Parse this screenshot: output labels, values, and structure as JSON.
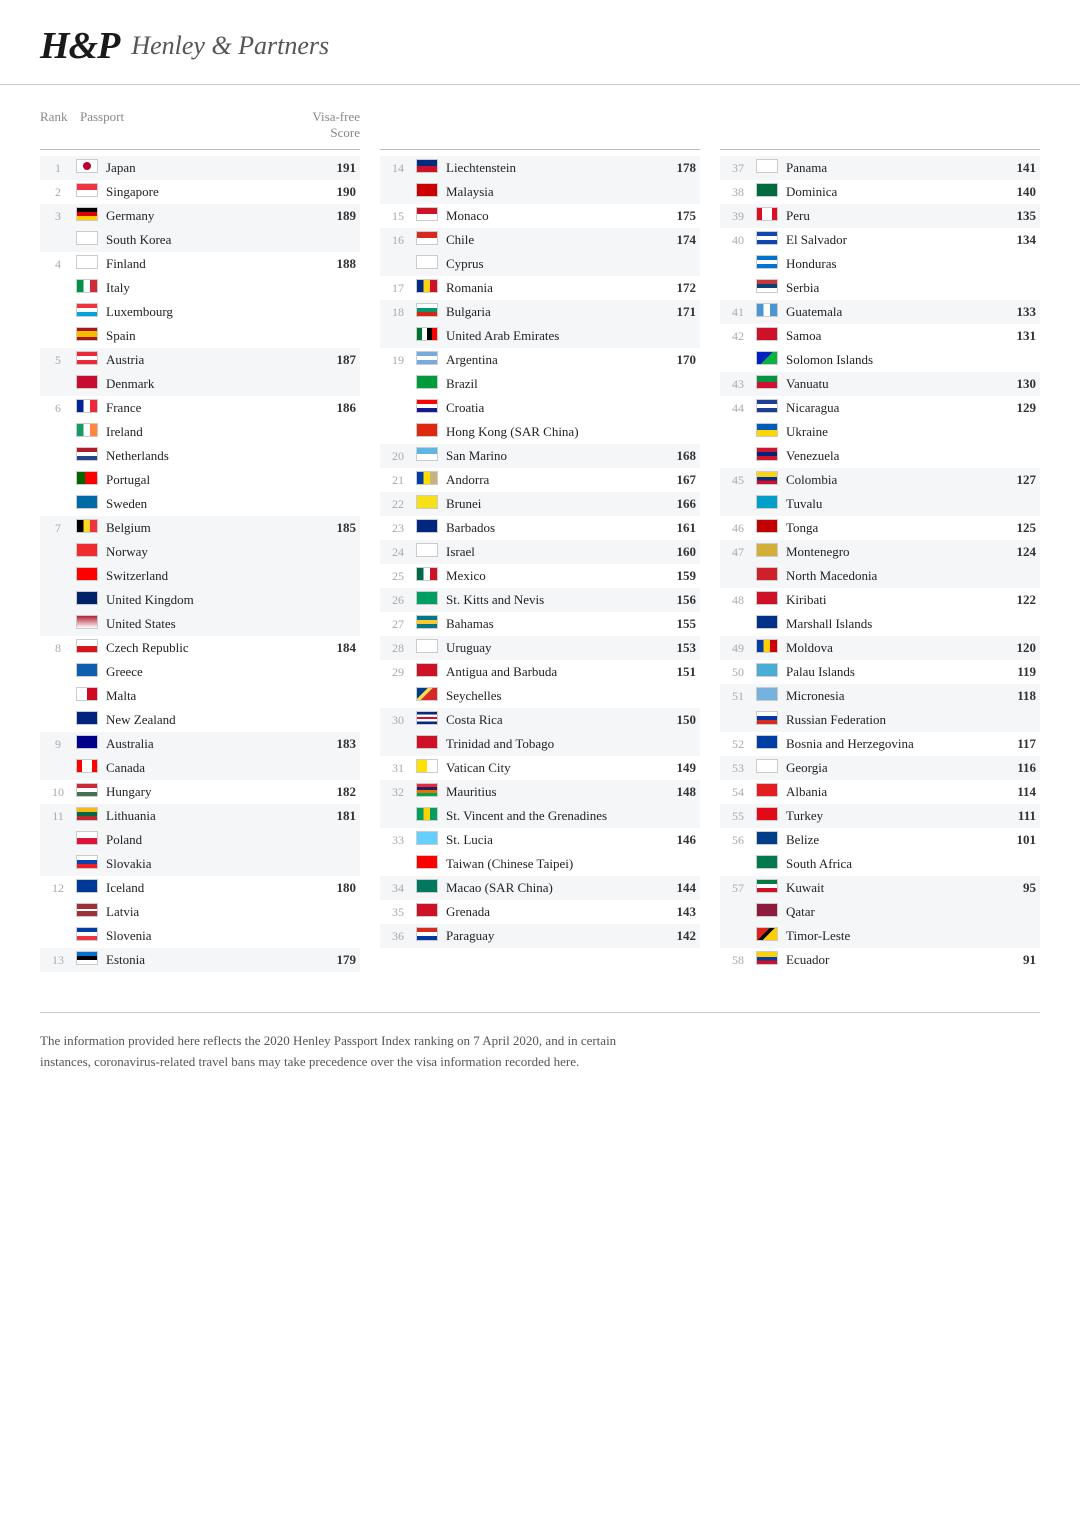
{
  "header": {
    "logo": "H&P",
    "name": "Henley & Partners"
  },
  "columns_header": {
    "rank": "Rank",
    "passport": "Passport",
    "score": "Visa-free Score"
  },
  "footer": {
    "text1": "The information provided here reflects the 2020 Henley Passport Index ranking on 7 April 2020, and in certain",
    "text2": "instances, coronavirus-related travel bans may take precedence over the visa information recorded here."
  },
  "col1": [
    {
      "rank": "1",
      "name": "Japan",
      "score": "191",
      "flag": "jp",
      "shaded": true
    },
    {
      "rank": "2",
      "name": "Singapore",
      "score": "190",
      "flag": "sg",
      "shaded": false
    },
    {
      "rank": "3",
      "name": "Germany",
      "score": "189",
      "flag": "de",
      "shaded": true
    },
    {
      "rank": "",
      "name": "South Korea",
      "score": "",
      "flag": "kr",
      "shaded": true
    },
    {
      "rank": "4",
      "name": "Finland",
      "score": "188",
      "flag": "fi",
      "shaded": false
    },
    {
      "rank": "",
      "name": "Italy",
      "score": "",
      "flag": "it",
      "shaded": false
    },
    {
      "rank": "",
      "name": "Luxembourg",
      "score": "",
      "flag": "lu",
      "shaded": false
    },
    {
      "rank": "",
      "name": "Spain",
      "score": "",
      "flag": "es",
      "shaded": false
    },
    {
      "rank": "5",
      "name": "Austria",
      "score": "187",
      "flag": "at",
      "shaded": true
    },
    {
      "rank": "",
      "name": "Denmark",
      "score": "",
      "flag": "dk",
      "shaded": true
    },
    {
      "rank": "6",
      "name": "France",
      "score": "186",
      "flag": "fr",
      "shaded": false
    },
    {
      "rank": "",
      "name": "Ireland",
      "score": "",
      "flag": "ie",
      "shaded": false
    },
    {
      "rank": "",
      "name": "Netherlands",
      "score": "",
      "flag": "nl",
      "shaded": false
    },
    {
      "rank": "",
      "name": "Portugal",
      "score": "",
      "flag": "pt",
      "shaded": false
    },
    {
      "rank": "",
      "name": "Sweden",
      "score": "",
      "flag": "se",
      "shaded": false
    },
    {
      "rank": "7",
      "name": "Belgium",
      "score": "185",
      "flag": "be",
      "shaded": true
    },
    {
      "rank": "",
      "name": "Norway",
      "score": "",
      "flag": "no",
      "shaded": true
    },
    {
      "rank": "",
      "name": "Switzerland",
      "score": "",
      "flag": "ch",
      "shaded": true
    },
    {
      "rank": "",
      "name": "United Kingdom",
      "score": "",
      "flag": "gb",
      "shaded": true
    },
    {
      "rank": "",
      "name": "United States",
      "score": "",
      "flag": "us",
      "shaded": true
    },
    {
      "rank": "8",
      "name": "Czech Republic",
      "score": "184",
      "flag": "cz",
      "shaded": false
    },
    {
      "rank": "",
      "name": "Greece",
      "score": "",
      "flag": "gr",
      "shaded": false
    },
    {
      "rank": "",
      "name": "Malta",
      "score": "",
      "flag": "mt",
      "shaded": false
    },
    {
      "rank": "",
      "name": "New Zealand",
      "score": "",
      "flag": "nz",
      "shaded": false
    },
    {
      "rank": "9",
      "name": "Australia",
      "score": "183",
      "flag": "au",
      "shaded": true
    },
    {
      "rank": "",
      "name": "Canada",
      "score": "",
      "flag": "ca",
      "shaded": true
    },
    {
      "rank": "10",
      "name": "Hungary",
      "score": "182",
      "flag": "hu",
      "shaded": false
    },
    {
      "rank": "11",
      "name": "Lithuania",
      "score": "181",
      "flag": "lt",
      "shaded": true
    },
    {
      "rank": "",
      "name": "Poland",
      "score": "",
      "flag": "pl",
      "shaded": true
    },
    {
      "rank": "",
      "name": "Slovakia",
      "score": "",
      "flag": "sk",
      "shaded": true
    },
    {
      "rank": "12",
      "name": "Iceland",
      "score": "180",
      "flag": "is",
      "shaded": false
    },
    {
      "rank": "",
      "name": "Latvia",
      "score": "",
      "flag": "lv",
      "shaded": false
    },
    {
      "rank": "",
      "name": "Slovenia",
      "score": "",
      "flag": "si",
      "shaded": false
    },
    {
      "rank": "13",
      "name": "Estonia",
      "score": "179",
      "flag": "ee",
      "shaded": true
    }
  ],
  "col2": [
    {
      "rank": "14",
      "name": "Liechtenstein",
      "score": "178",
      "flag": "li",
      "shaded": true
    },
    {
      "rank": "",
      "name": "Malaysia",
      "score": "",
      "flag": "my",
      "shaded": true
    },
    {
      "rank": "15",
      "name": "Monaco",
      "score": "175",
      "flag": "mc",
      "shaded": false
    },
    {
      "rank": "16",
      "name": "Chile",
      "score": "174",
      "flag": "cl",
      "shaded": true
    },
    {
      "rank": "",
      "name": "Cyprus",
      "score": "",
      "flag": "cy",
      "shaded": true
    },
    {
      "rank": "17",
      "name": "Romania",
      "score": "172",
      "flag": "ro",
      "shaded": false
    },
    {
      "rank": "18",
      "name": "Bulgaria",
      "score": "171",
      "flag": "bg",
      "shaded": true
    },
    {
      "rank": "",
      "name": "United Arab Emirates",
      "score": "",
      "flag": "ae",
      "shaded": true
    },
    {
      "rank": "19",
      "name": "Argentina",
      "score": "170",
      "flag": "ar",
      "shaded": false
    },
    {
      "rank": "",
      "name": "Brazil",
      "score": "",
      "flag": "br",
      "shaded": false
    },
    {
      "rank": "",
      "name": "Croatia",
      "score": "",
      "flag": "hr",
      "shaded": false
    },
    {
      "rank": "",
      "name": "Hong Kong (SAR China)",
      "score": "",
      "flag": "hk",
      "shaded": false
    },
    {
      "rank": "20",
      "name": "San Marino",
      "score": "168",
      "flag": "sm",
      "shaded": true
    },
    {
      "rank": "21",
      "name": "Andorra",
      "score": "167",
      "flag": "ad",
      "shaded": false
    },
    {
      "rank": "22",
      "name": "Brunei",
      "score": "166",
      "flag": "bn",
      "shaded": true
    },
    {
      "rank": "23",
      "name": "Barbados",
      "score": "161",
      "flag": "bb",
      "shaded": false
    },
    {
      "rank": "24",
      "name": "Israel",
      "score": "160",
      "flag": "il",
      "shaded": true
    },
    {
      "rank": "25",
      "name": "Mexico",
      "score": "159",
      "flag": "mx",
      "shaded": false
    },
    {
      "rank": "26",
      "name": "St. Kitts and Nevis",
      "score": "156",
      "flag": "kn",
      "shaded": true
    },
    {
      "rank": "27",
      "name": "Bahamas",
      "score": "155",
      "flag": "bs",
      "shaded": false
    },
    {
      "rank": "28",
      "name": "Uruguay",
      "score": "153",
      "flag": "uy",
      "shaded": true
    },
    {
      "rank": "29",
      "name": "Antigua and Barbuda",
      "score": "151",
      "flag": "ag",
      "shaded": false
    },
    {
      "rank": "",
      "name": "Seychelles",
      "score": "",
      "flag": "sc",
      "shaded": false
    },
    {
      "rank": "30",
      "name": "Costa Rica",
      "score": "150",
      "flag": "cr",
      "shaded": true
    },
    {
      "rank": "",
      "name": "Trinidad and Tobago",
      "score": "",
      "flag": "tt",
      "shaded": true
    },
    {
      "rank": "31",
      "name": "Vatican City",
      "score": "149",
      "flag": "va",
      "shaded": false
    },
    {
      "rank": "32",
      "name": "Mauritius",
      "score": "148",
      "flag": "mu",
      "shaded": true
    },
    {
      "rank": "",
      "name": "St. Vincent and the Grenadines",
      "score": "",
      "flag": "vc",
      "shaded": true
    },
    {
      "rank": "33",
      "name": "St. Lucia",
      "score": "146",
      "flag": "lc",
      "shaded": false
    },
    {
      "rank": "",
      "name": "Taiwan (Chinese Taipei)",
      "score": "",
      "flag": "tw",
      "shaded": false
    },
    {
      "rank": "34",
      "name": "Macao (SAR China)",
      "score": "144",
      "flag": "mo",
      "shaded": true
    },
    {
      "rank": "35",
      "name": "Grenada",
      "score": "143",
      "flag": "gd",
      "shaded": false
    },
    {
      "rank": "36",
      "name": "Paraguay",
      "score": "142",
      "flag": "py",
      "shaded": true
    }
  ],
  "col3": [
    {
      "rank": "37",
      "name": "Panama",
      "score": "141",
      "flag": "pa",
      "shaded": true
    },
    {
      "rank": "38",
      "name": "Dominica",
      "score": "140",
      "flag": "dm",
      "shaded": false
    },
    {
      "rank": "39",
      "name": "Peru",
      "score": "135",
      "flag": "pe",
      "shaded": true
    },
    {
      "rank": "40",
      "name": "El Salvador",
      "score": "134",
      "flag": "sv",
      "shaded": false
    },
    {
      "rank": "",
      "name": "Honduras",
      "score": "",
      "flag": "hn",
      "shaded": false
    },
    {
      "rank": "",
      "name": "Serbia",
      "score": "",
      "flag": "rs",
      "shaded": false
    },
    {
      "rank": "41",
      "name": "Guatemala",
      "score": "133",
      "flag": "gt",
      "shaded": true
    },
    {
      "rank": "42",
      "name": "Samoa",
      "score": "131",
      "flag": "ws",
      "shaded": false
    },
    {
      "rank": "",
      "name": "Solomon Islands",
      "score": "",
      "flag": "sb",
      "shaded": false
    },
    {
      "rank": "43",
      "name": "Vanuatu",
      "score": "130",
      "flag": "vu",
      "shaded": true
    },
    {
      "rank": "44",
      "name": "Nicaragua",
      "score": "129",
      "flag": "ni",
      "shaded": false
    },
    {
      "rank": "",
      "name": "Ukraine",
      "score": "",
      "flag": "ua",
      "shaded": false
    },
    {
      "rank": "",
      "name": "Venezuela",
      "score": "",
      "flag": "ve",
      "shaded": false
    },
    {
      "rank": "45",
      "name": "Colombia",
      "score": "127",
      "flag": "co",
      "shaded": true
    },
    {
      "rank": "",
      "name": "Tuvalu",
      "score": "",
      "flag": "tv",
      "shaded": true
    },
    {
      "rank": "46",
      "name": "Tonga",
      "score": "125",
      "flag": "to",
      "shaded": false
    },
    {
      "rank": "47",
      "name": "Montenegro",
      "score": "124",
      "flag": "me",
      "shaded": true
    },
    {
      "rank": "",
      "name": "North Macedonia",
      "score": "",
      "flag": "mk",
      "shaded": true
    },
    {
      "rank": "48",
      "name": "Kiribati",
      "score": "122",
      "flag": "ki",
      "shaded": false
    },
    {
      "rank": "",
      "name": "Marshall Islands",
      "score": "",
      "flag": "mh",
      "shaded": false
    },
    {
      "rank": "49",
      "name": "Moldova",
      "score": "120",
      "flag": "md",
      "shaded": true
    },
    {
      "rank": "50",
      "name": "Palau Islands",
      "score": "119",
      "flag": "pw",
      "shaded": false
    },
    {
      "rank": "51",
      "name": "Micronesia",
      "score": "118",
      "flag": "fm",
      "shaded": true
    },
    {
      "rank": "",
      "name": "Russian Federation",
      "score": "",
      "flag": "ru",
      "shaded": true
    },
    {
      "rank": "52",
      "name": "Bosnia and Herzegovina",
      "score": "117",
      "flag": "ba",
      "shaded": false
    },
    {
      "rank": "53",
      "name": "Georgia",
      "score": "116",
      "flag": "ge",
      "shaded": true
    },
    {
      "rank": "54",
      "name": "Albania",
      "score": "114",
      "flag": "al",
      "shaded": false
    },
    {
      "rank": "55",
      "name": "Turkey",
      "score": "111",
      "flag": "tr",
      "shaded": true
    },
    {
      "rank": "56",
      "name": "Belize",
      "score": "101",
      "flag": "bz",
      "shaded": false
    },
    {
      "rank": "",
      "name": "South Africa",
      "score": "",
      "flag": "za",
      "shaded": false
    },
    {
      "rank": "57",
      "name": "Kuwait",
      "score": "95",
      "flag": "kw",
      "shaded": true
    },
    {
      "rank": "",
      "name": "Qatar",
      "score": "",
      "flag": "qa",
      "shaded": true
    },
    {
      "rank": "",
      "name": "Timor-Leste",
      "score": "",
      "flag": "tl",
      "shaded": true
    },
    {
      "rank": "58",
      "name": "Ecuador",
      "score": "91",
      "flag": "ec",
      "shaded": false
    }
  ]
}
